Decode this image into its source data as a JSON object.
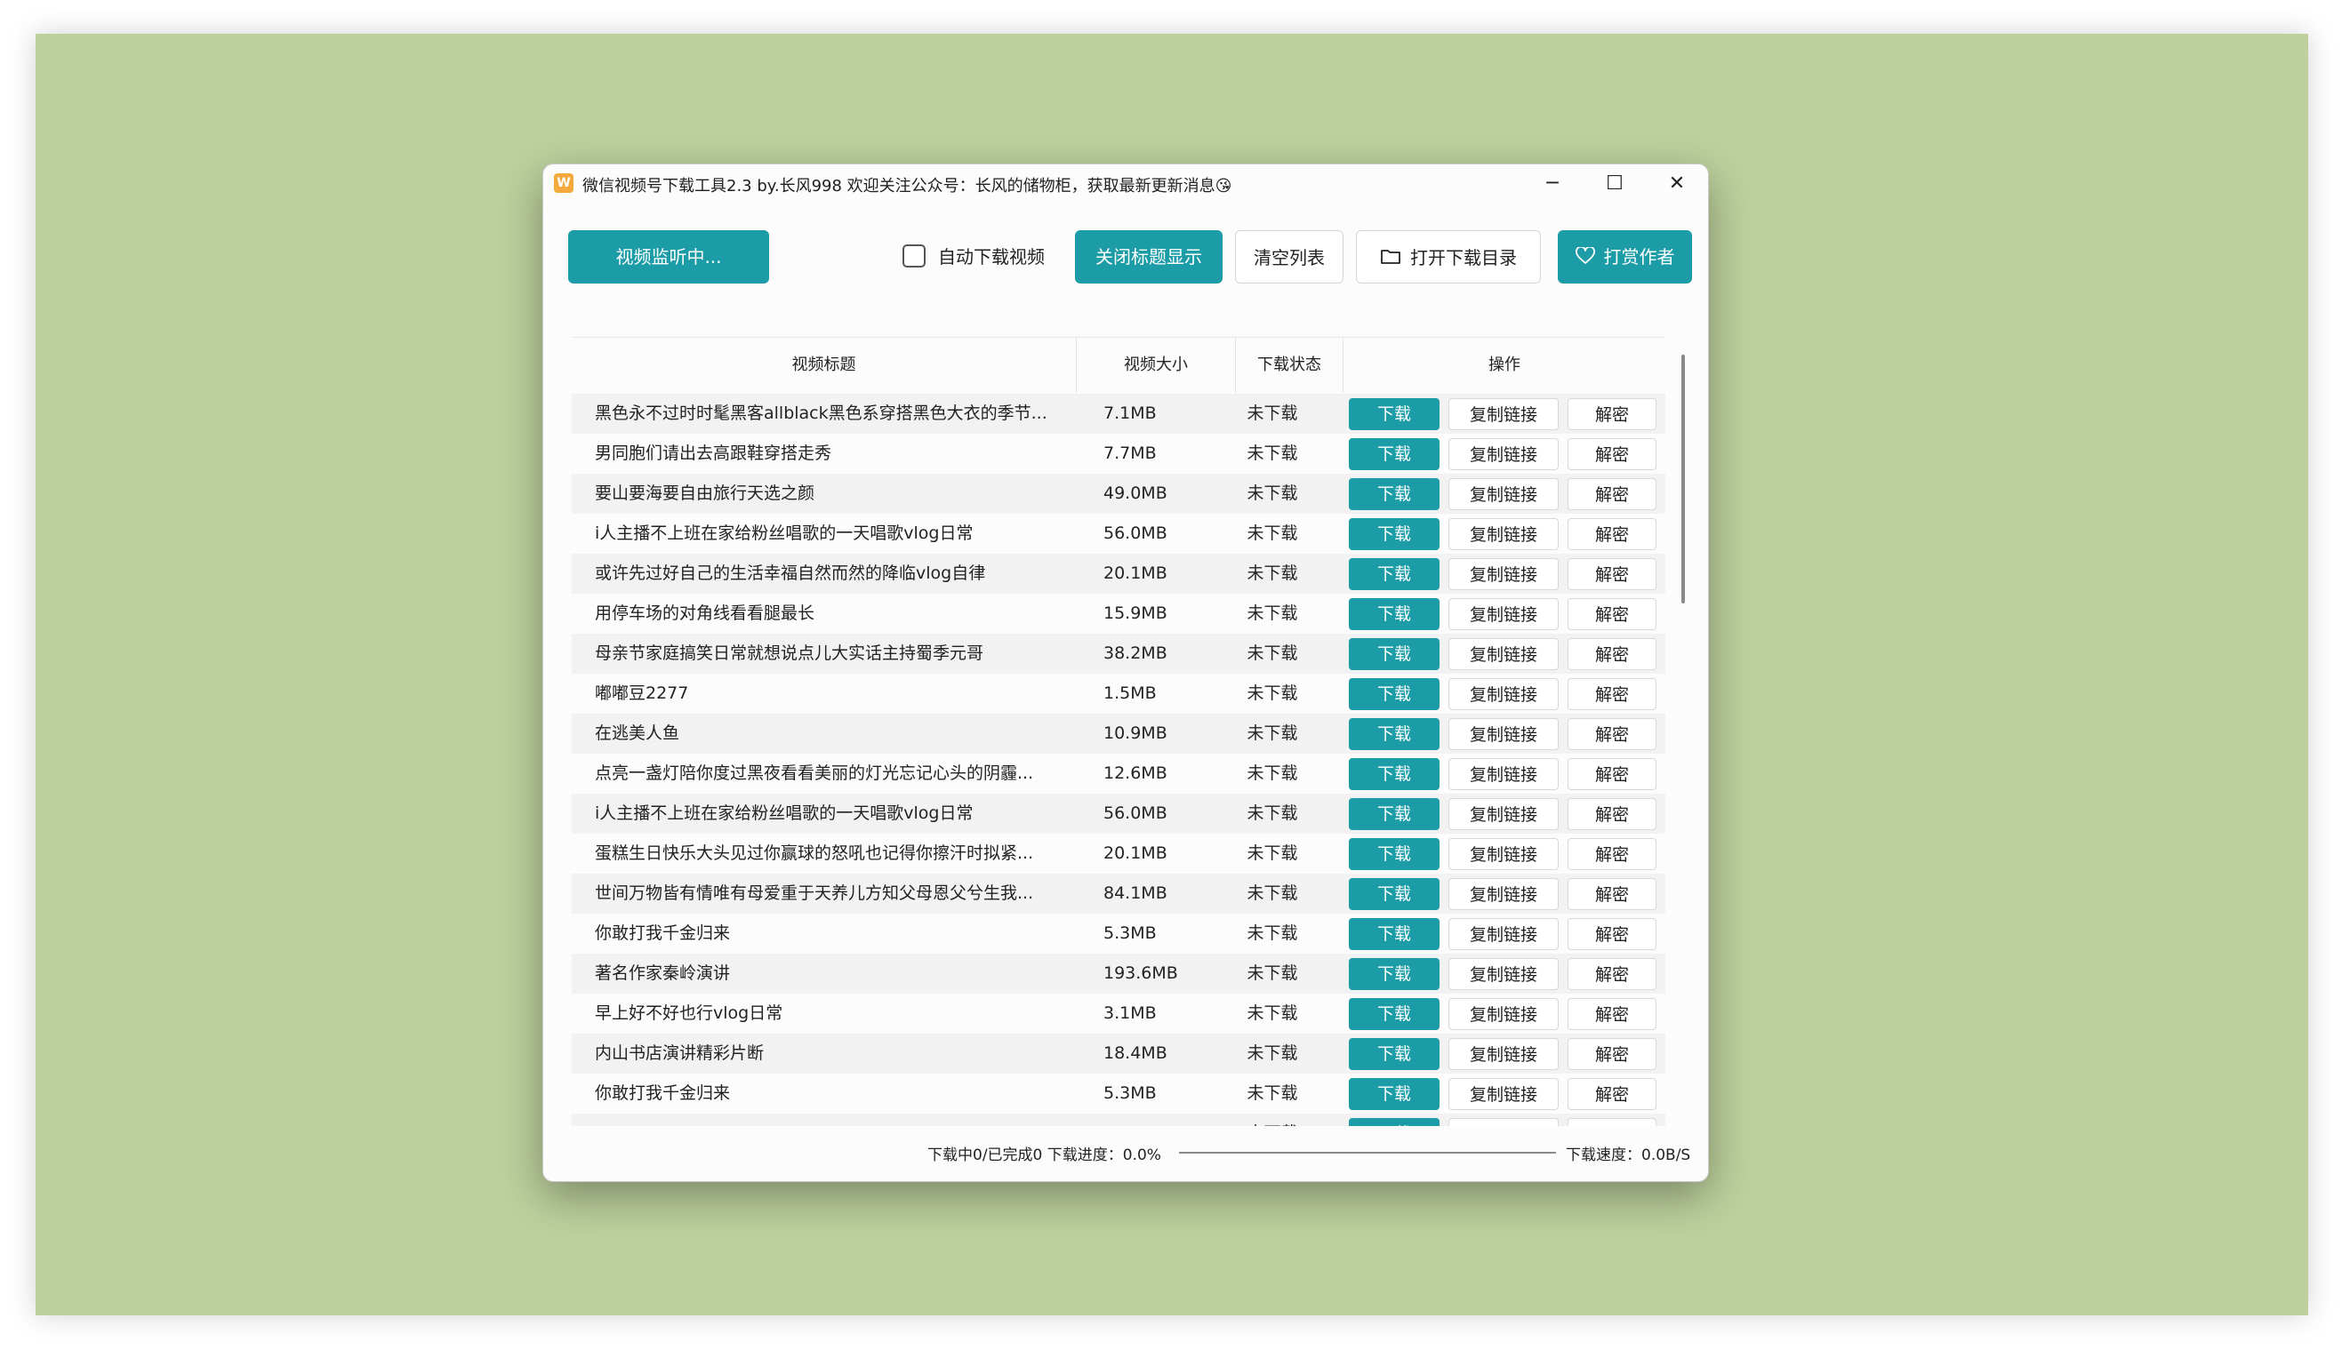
{
  "window": {
    "icon_letter": "W",
    "title": "微信视频号下载工具2.3 by.长风998  欢迎关注公众号：长风的储物柜，获取最新更新消息😘",
    "controls": {
      "minimize": "─",
      "maximize": "☐",
      "close": "✕"
    }
  },
  "toolbar": {
    "monitor_label": "视频监听中...",
    "auto_download_label": "自动下载视频",
    "auto_download_checked": false,
    "toggle_title_label": "关闭标题显示",
    "clear_label": "清空列表",
    "open_dir_label": "打开下载目录",
    "donate_label": "打赏作者"
  },
  "table": {
    "headers": {
      "title": "视频标题",
      "size": "视频大小",
      "status": "下载状态",
      "actions": "操作"
    },
    "action_labels": {
      "download": "下载",
      "copy": "复制链接",
      "decrypt": "解密"
    },
    "rows": [
      {
        "title": "黑色永不过时时髦黑客allblack黑色系穿搭黑色大衣的季节...",
        "size": "7.1MB",
        "status": "未下载"
      },
      {
        "title": "男同胞们请出去高跟鞋穿搭走秀",
        "size": "7.7MB",
        "status": "未下载"
      },
      {
        "title": "要山要海要自由旅行天选之颜",
        "size": "49.0MB",
        "status": "未下载"
      },
      {
        "title": "i人主播不上班在家给粉丝唱歌的一天唱歌vlog日常",
        "size": "56.0MB",
        "status": "未下载"
      },
      {
        "title": "或许先过好自己的生活幸福自然而然的降临vlog自律",
        "size": "20.1MB",
        "status": "未下载"
      },
      {
        "title": "用停车场的对角线看看腿最长",
        "size": "15.9MB",
        "status": "未下载"
      },
      {
        "title": "母亲节家庭搞笑日常就想说点儿大实话主持蜀季元哥",
        "size": "38.2MB",
        "status": "未下载"
      },
      {
        "title": "嘟嘟豆2277",
        "size": "1.5MB",
        "status": "未下载"
      },
      {
        "title": "在逃美人鱼",
        "size": "10.9MB",
        "status": "未下载"
      },
      {
        "title": "点亮一盏灯陪你度过黑夜看看美丽的灯光忘记心头的阴霾...",
        "size": "12.6MB",
        "status": "未下载"
      },
      {
        "title": "i人主播不上班在家给粉丝唱歌的一天唱歌vlog日常",
        "size": "56.0MB",
        "status": "未下载"
      },
      {
        "title": "蛋糕生日快乐大头见过你赢球的怒吼也记得你擦汗时拟紧...",
        "size": "20.1MB",
        "status": "未下载"
      },
      {
        "title": "世间万物皆有情唯有母爱重于天养儿方知父母恩父兮生我...",
        "size": "84.1MB",
        "status": "未下载"
      },
      {
        "title": "你敢打我千金归来",
        "size": "5.3MB",
        "status": "未下载"
      },
      {
        "title": "著名作家秦岭演讲",
        "size": "193.6MB",
        "status": "未下载"
      },
      {
        "title": "早上好不好也行vlog日常",
        "size": "3.1MB",
        "status": "未下载"
      },
      {
        "title": "内山书店演讲精彩片断",
        "size": "18.4MB",
        "status": "未下载"
      },
      {
        "title": "你敢打我千金归来",
        "size": "5.3MB",
        "status": "未下载"
      },
      {
        "title": "",
        "size": "",
        "status": "未下载"
      }
    ]
  },
  "status": {
    "progress_text": "下载中0/已完成0  下载进度：0.0%",
    "progress_fraction": 0.0,
    "speed_text": "下载速度：0.0B/S"
  },
  "colors": {
    "accent": "#1b9ca6",
    "background": "#bdd09d"
  }
}
